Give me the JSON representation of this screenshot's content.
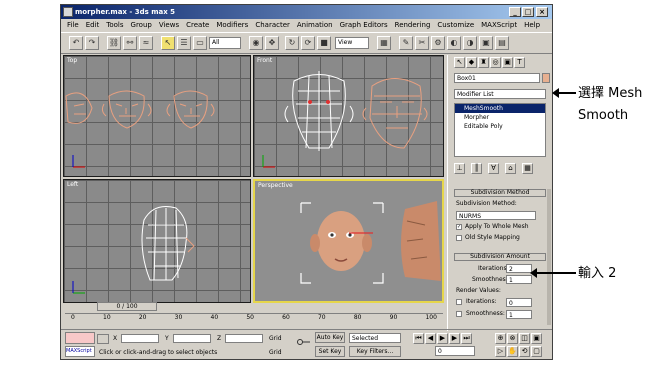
{
  "window": {
    "title": "morpher.max - 3ds max 5",
    "controls": [
      "_",
      "□",
      "×"
    ]
  },
  "menu": [
    "File",
    "Edit",
    "Tools",
    "Group",
    "Views",
    "Create",
    "Modifiers",
    "Character",
    "Animation",
    "Graph Editors",
    "Rendering",
    "Customize",
    "MAXScript",
    "Help"
  ],
  "toolbar": {
    "selection_filter": "All",
    "ref_coord": "View"
  },
  "viewports": {
    "top_left": "Top",
    "top_right": "Front",
    "bottom_left": "Left",
    "bottom_right": "Perspective"
  },
  "command_panel": {
    "object_name": "Box01",
    "modifier_list": "Modifier List",
    "stack": [
      "MeshSmooth",
      "Morpher",
      "Editable Poly"
    ],
    "subdivision_method": {
      "header": "Subdivision Method",
      "label": "Subdivision Method:",
      "value": "NURMS",
      "apply_whole_mesh": "Apply To Whole Mesh",
      "old_style": "Old Style Mapping"
    },
    "subdivision_amount": {
      "header": "Subdivision Amount",
      "iterations_label": "Iterations:",
      "iterations_value": "2",
      "smoothness_label": "Smoothness:",
      "smoothness_value": "1",
      "render_values": "Render Values:",
      "render_iterations": "Iterations:",
      "render_iterations_value": "0",
      "render_smoothness": "Smoothness:",
      "render_smoothness_value": "1"
    }
  },
  "timeline": {
    "frame": "0 / 100",
    "ticks": [
      "0",
      "10",
      "20",
      "30",
      "40",
      "50",
      "60",
      "70",
      "80",
      "90",
      "100"
    ]
  },
  "status": {
    "maxscript": "MAXScript",
    "prompt": "Click or click-and-drag to select objects",
    "x_label": "X",
    "y_label": "Y",
    "z_label": "Z",
    "grid": "Grid",
    "autokey": "Auto Key",
    "selected": "Selected",
    "setkey": "Set Key",
    "keyfilters": "Key Filters...",
    "frame_value": "0"
  },
  "annotations": {
    "select_meshsmooth": "選擇 Mesh\nSmooth",
    "enter_2": "輸入 2"
  },
  "colors": {
    "titlebar": "#0a246a",
    "selection": "#0a246a",
    "persp_border": "#e6d64a",
    "mesh_white": "#ffffff",
    "mesh_salmon": "#e8a080"
  }
}
